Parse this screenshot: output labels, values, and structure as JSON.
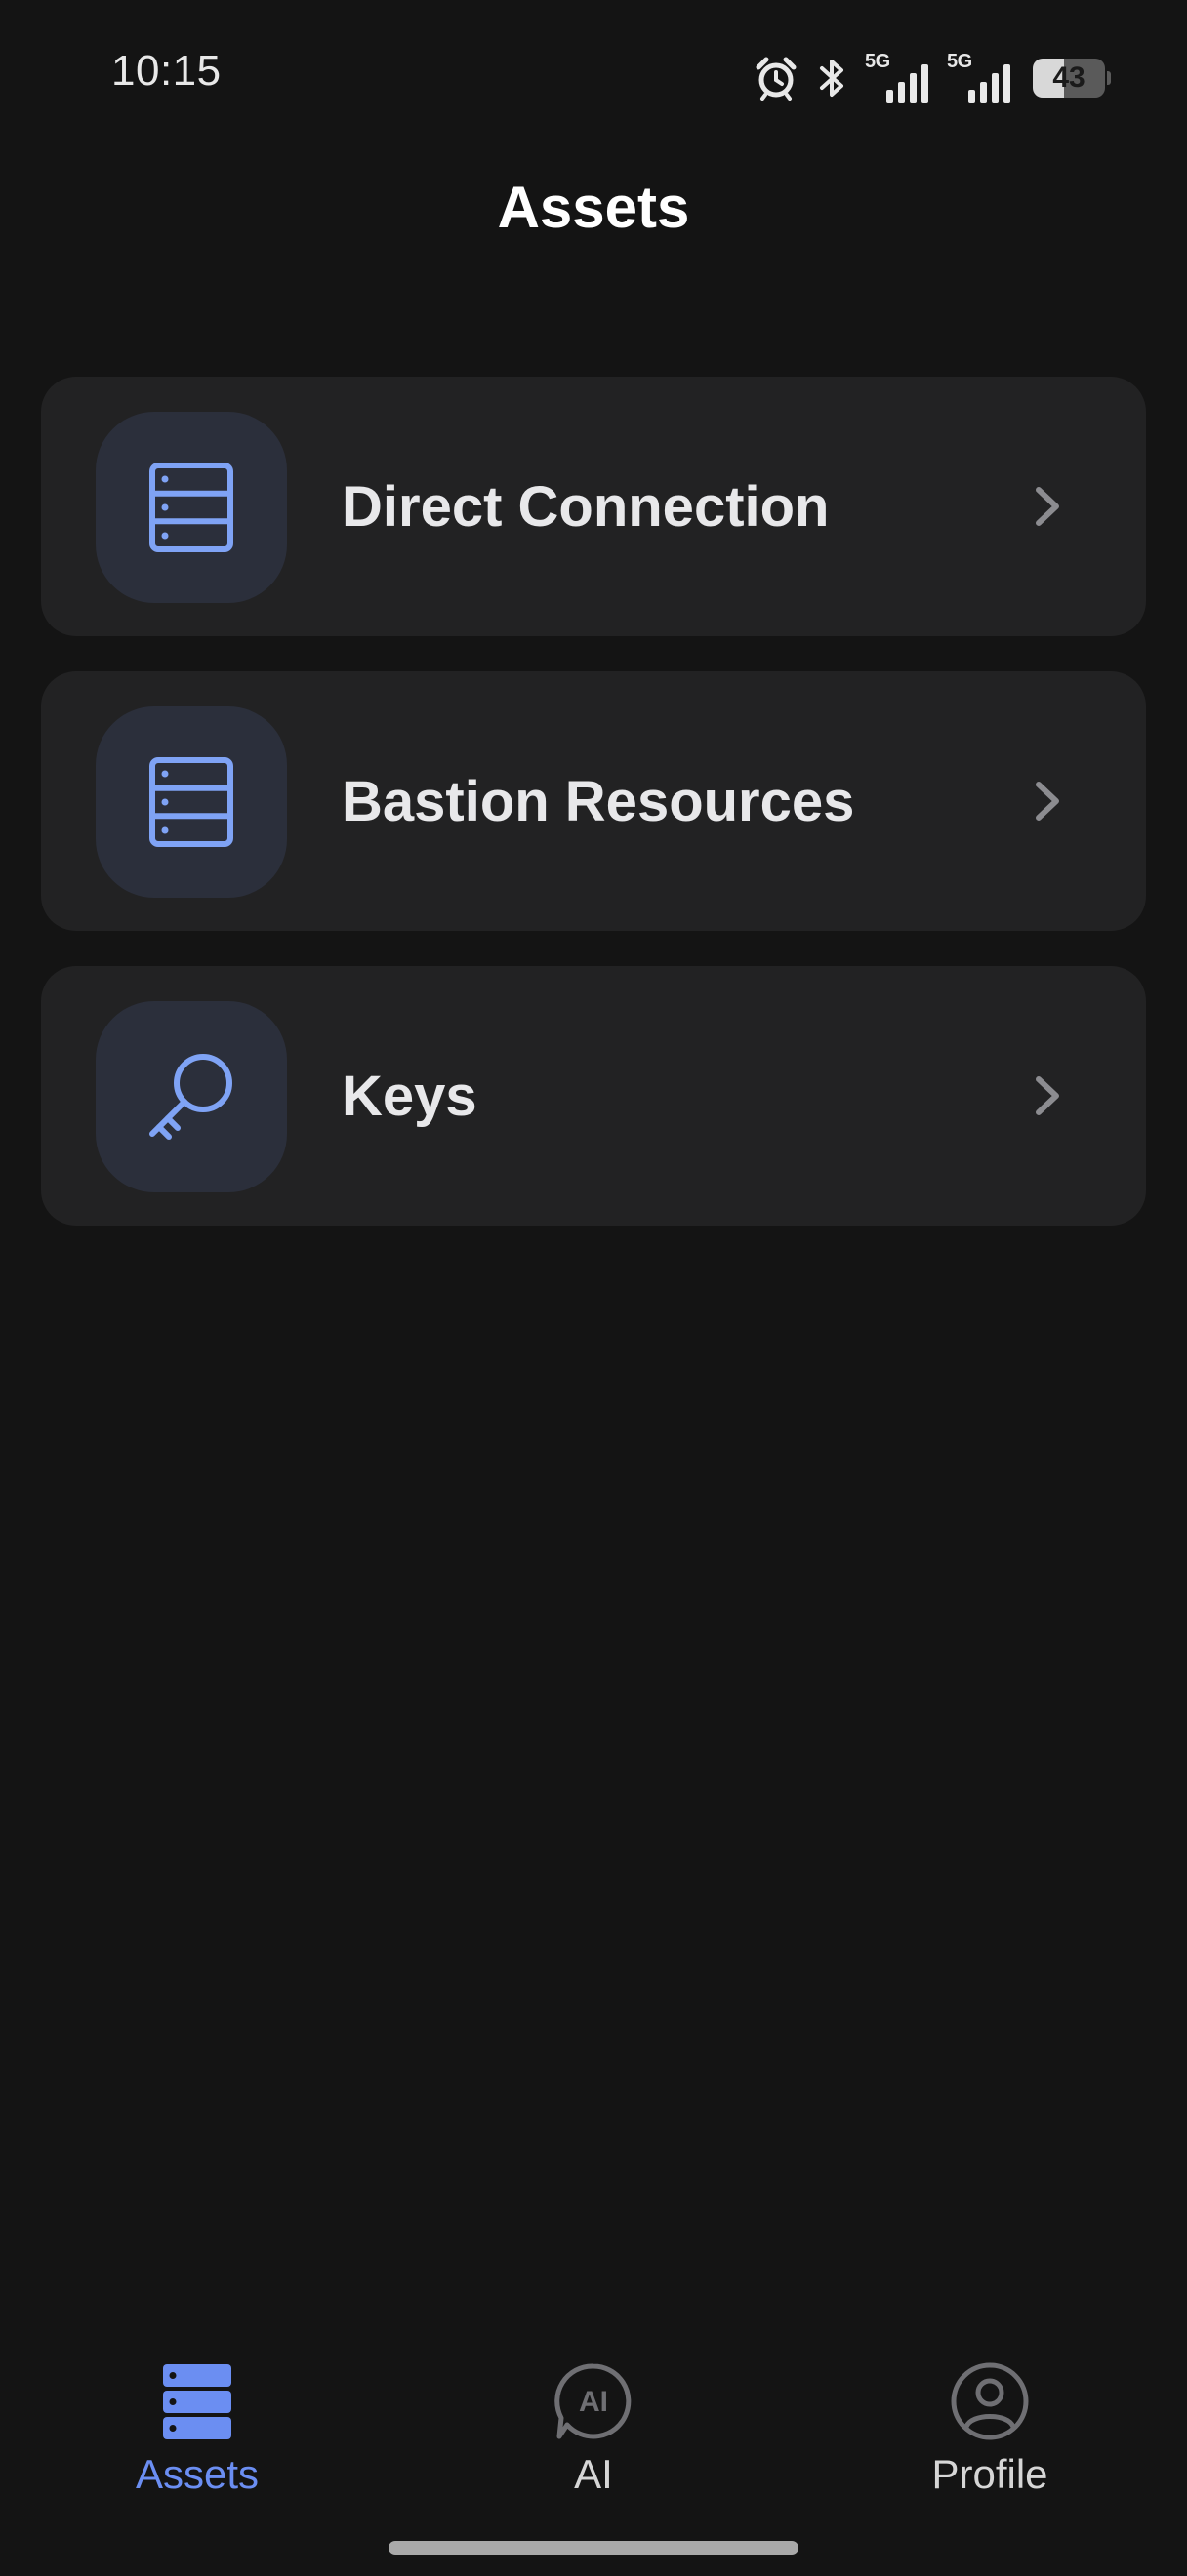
{
  "status_bar": {
    "time": "10:15",
    "signal_1_label": "5G",
    "signal_2_label": "5G",
    "battery_level": "43",
    "battery_fraction": 0.43
  },
  "header": {
    "title": "Assets"
  },
  "menu": {
    "items": [
      {
        "label": "Direct Connection",
        "icon": "server-icon"
      },
      {
        "label": "Bastion Resources",
        "icon": "server-icon"
      },
      {
        "label": "Keys",
        "icon": "key-icon"
      }
    ]
  },
  "tab_bar": {
    "tabs": [
      {
        "label": "Assets",
        "icon": "server-stack-icon",
        "active": true
      },
      {
        "label": "AI",
        "icon": "ai-chat-icon",
        "active": false
      },
      {
        "label": "Profile",
        "icon": "user-circle-icon",
        "active": false
      }
    ]
  },
  "colors": {
    "background": "#141414",
    "card": "#222223",
    "icon_tile": "#2b2f3b",
    "accent": "#6b8ef2",
    "icon_stroke": "#7fa3f5"
  }
}
